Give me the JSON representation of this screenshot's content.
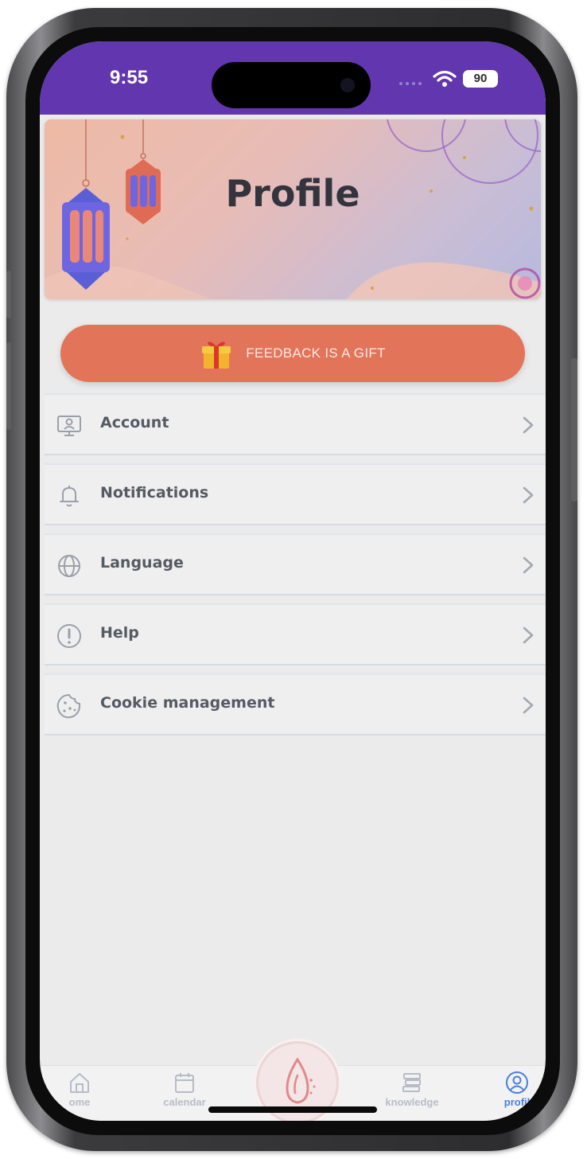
{
  "status_bar": {
    "time": "9:55",
    "battery": "90",
    "background": "#6236ae"
  },
  "header": {
    "title": "Profile",
    "banner_theme": "lanterns"
  },
  "feedback": {
    "label": "FEEDBACK IS A GIFT",
    "icon": "gift-icon",
    "color": "#e2745a"
  },
  "menu": {
    "items": [
      {
        "label": "Account",
        "icon": "account-icon"
      },
      {
        "label": "Notifications",
        "icon": "bell-icon"
      },
      {
        "label": "Language",
        "icon": "globe-icon"
      },
      {
        "label": "Help",
        "icon": "info-icon"
      },
      {
        "label": "Cookie management",
        "icon": "cookie-icon"
      }
    ]
  },
  "tab_bar": {
    "tabs": [
      {
        "label": "ome",
        "icon": "home-icon",
        "active": false
      },
      {
        "label": "calendar",
        "icon": "calendar-icon",
        "active": false
      },
      {
        "label": "knowledge",
        "icon": "books-icon",
        "active": false
      },
      {
        "label": "profil",
        "icon": "profile-icon",
        "active": true
      }
    ],
    "center_button_icon": "drop-logo-icon",
    "active_color": "#4a7fd6"
  }
}
